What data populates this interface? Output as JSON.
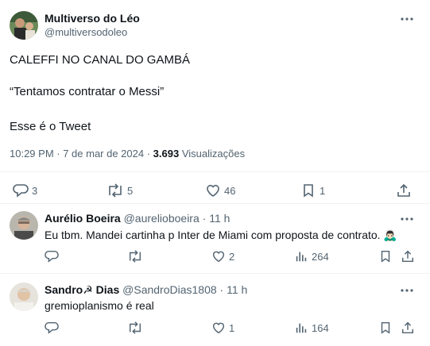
{
  "tweet": {
    "author_name": "Multiverso do Léo",
    "author_handle": "@multiversodoleo",
    "lines": [
      "CALEFFI NO CANAL DO GAMBÁ",
      "“Tentamos contratar o Messi”",
      "Esse é o Tweet"
    ],
    "time": "10:29 PM · 7 de mar de 2024 · ",
    "views_count": "3.693",
    "views_label": " Visualizações",
    "actions": {
      "replies": "3",
      "retweets": "5",
      "likes": "46",
      "bookmarks": "1"
    }
  },
  "replies": [
    {
      "name": "Aurélio Boeira",
      "handle": "@aurelioboeira",
      "time": " · 11 h",
      "text": "Eu tbm. Mandei cartinha p Inter de Miami com proposta de contrato. 🙇🏻‍♂️",
      "likes": "2",
      "views": "264"
    },
    {
      "name": "Sandro☭ Dias",
      "handle": "@SandroDias1808",
      "time": " · 11 h",
      "text": "gremioplanismo é real",
      "likes": "1",
      "views": "164"
    }
  ],
  "icons": [
    "more-icon",
    "reply-icon",
    "retweet-icon",
    "like-icon",
    "bookmark-icon",
    "share-icon",
    "views-icon"
  ],
  "colors": {
    "text": "#0f1419",
    "secondary": "#536471",
    "divider": "#eff3f4"
  }
}
